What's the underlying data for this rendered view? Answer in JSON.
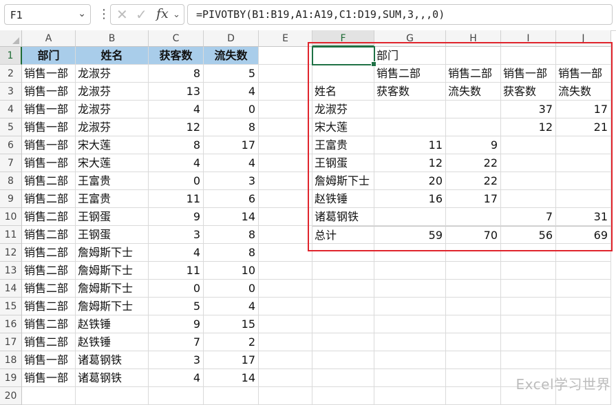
{
  "formula_bar": {
    "name_box": "F1",
    "name_box_dropdown_icon": "chevron-down-icon",
    "more_icon": "vertical-dots-icon",
    "cancel_icon": "x-icon",
    "enter_icon": "check-icon",
    "fx_label": "fx",
    "formula": "=PIVOTBY(B1:B19,A1:A19,C1:D19,SUM,3,,,0)"
  },
  "columns": [
    "A",
    "B",
    "C",
    "D",
    "E",
    "F",
    "G",
    "H",
    "I",
    "J"
  ],
  "rows": [
    "1",
    "2",
    "3",
    "4",
    "5",
    "6",
    "7",
    "8",
    "9",
    "10",
    "11",
    "12",
    "13",
    "14",
    "15",
    "16",
    "17",
    "18",
    "19",
    "20"
  ],
  "source_table": {
    "headers": [
      "部门",
      "姓名",
      "获客数",
      "流失数"
    ],
    "rows": [
      [
        "销售一部",
        "龙淑芬",
        "8",
        "5"
      ],
      [
        "销售一部",
        "龙淑芬",
        "13",
        "4"
      ],
      [
        "销售一部",
        "龙淑芬",
        "4",
        "0"
      ],
      [
        "销售一部",
        "龙淑芬",
        "12",
        "8"
      ],
      [
        "销售一部",
        "宋大莲",
        "8",
        "17"
      ],
      [
        "销售一部",
        "宋大莲",
        "4",
        "4"
      ],
      [
        "销售二部",
        "王富贵",
        "0",
        "3"
      ],
      [
        "销售二部",
        "王富贵",
        "11",
        "6"
      ],
      [
        "销售二部",
        "王钢蛋",
        "9",
        "14"
      ],
      [
        "销售二部",
        "王钢蛋",
        "3",
        "8"
      ],
      [
        "销售二部",
        "詹姆斯下士",
        "4",
        "8"
      ],
      [
        "销售二部",
        "詹姆斯下士",
        "11",
        "10"
      ],
      [
        "销售二部",
        "詹姆斯下士",
        "0",
        "0"
      ],
      [
        "销售二部",
        "詹姆斯下士",
        "5",
        "4"
      ],
      [
        "销售二部",
        "赵铁锤",
        "9",
        "15"
      ],
      [
        "销售二部",
        "赵铁锤",
        "7",
        "2"
      ],
      [
        "销售一部",
        "诸葛钢铁",
        "3",
        "17"
      ],
      [
        "销售一部",
        "诸葛钢铁",
        "4",
        "14"
      ]
    ]
  },
  "pivot": {
    "rows": [
      [
        "",
        "部门",
        "",
        "",
        ""
      ],
      [
        "",
        "销售二部",
        "销售二部",
        "销售一部",
        "销售一部"
      ],
      [
        "姓名",
        "获客数",
        "流失数",
        "获客数",
        "流失数"
      ],
      [
        "龙淑芬",
        "",
        "",
        "37",
        "17"
      ],
      [
        "宋大莲",
        "",
        "",
        "12",
        "21"
      ],
      [
        "王富贵",
        "11",
        "9",
        "",
        ""
      ],
      [
        "王钢蛋",
        "12",
        "22",
        "",
        ""
      ],
      [
        "詹姆斯下士",
        "20",
        "22",
        "",
        ""
      ],
      [
        "赵铁锤",
        "16",
        "17",
        "",
        ""
      ],
      [
        "诸葛钢铁",
        "",
        "",
        "7",
        "31"
      ],
      [
        "总计",
        "59",
        "70",
        "56",
        "69"
      ]
    ]
  },
  "watermark": "Excel学习世界",
  "colors": {
    "header_fill": "#a9cdea",
    "highlight_border": "#e0242c",
    "selection": "#1e7145"
  }
}
